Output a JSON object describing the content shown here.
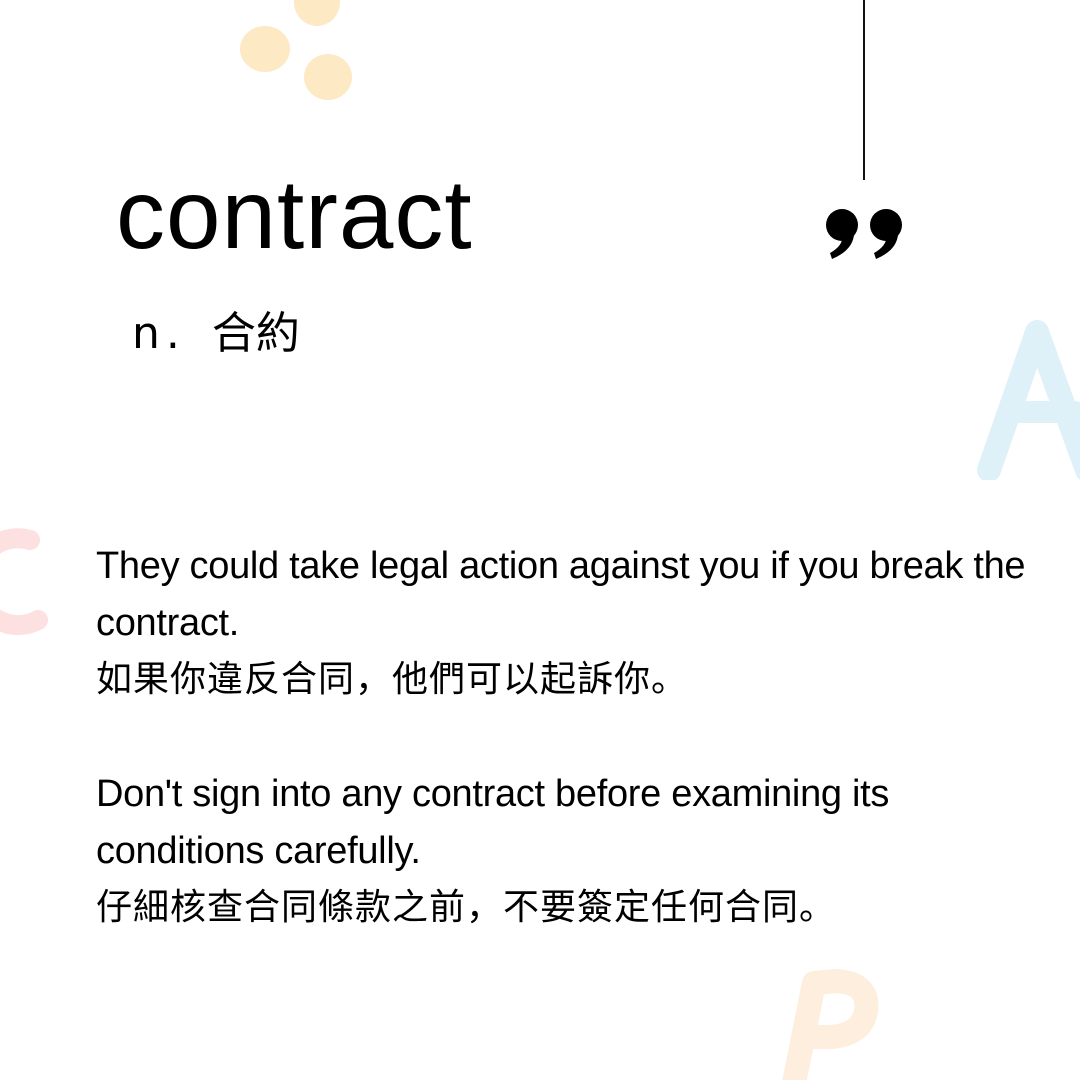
{
  "entry": {
    "word": "contract",
    "part_of_speech": "n.",
    "translation": "合約"
  },
  "examples": [
    {
      "en": "They could take legal action against you if you break the contract.",
      "zh": "如果你違反合同，他們可以起訴你。"
    },
    {
      "en": "Don't sign into any contract before examining its conditions carefully.",
      "zh": "仔細核查合同條款之前，不要簽定任何合同。"
    }
  ],
  "decorations": {
    "letters": [
      "A",
      "C",
      "B"
    ],
    "colors": {
      "dots": "#fde9c4",
      "letter_a": "#dff1f8",
      "letter_c": "#fde0e0",
      "letter_b": "#fdeede"
    },
    "quote_icon": "closing-quote-icon"
  }
}
